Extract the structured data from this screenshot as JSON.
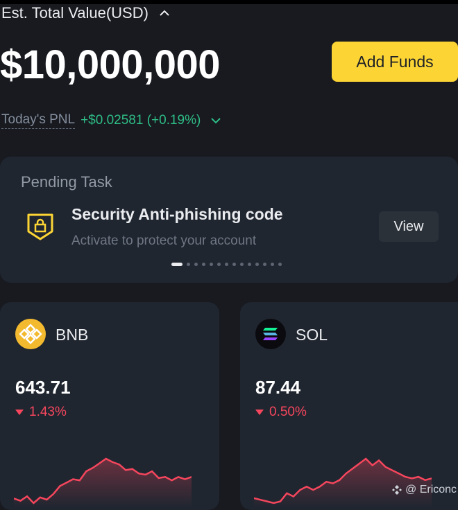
{
  "header": {
    "est_label": "Est. Total Value(USD)",
    "total_value": "$10,000,000",
    "add_funds_label": "Add Funds",
    "pnl_label": "Today's PNL",
    "pnl_value": "+$0.02581 (+0.19%)"
  },
  "pending": {
    "title": "Pending Task",
    "task_title": "Security Anti-phishing code",
    "task_subtitle": "Activate to protect your account",
    "view_label": "View",
    "pager": {
      "count": 14,
      "active": 0
    }
  },
  "cards": [
    {
      "name": "BNB",
      "price": "643.71",
      "change": "1.43%",
      "icon": "bnb-logo-icon",
      "sparkline": [
        22,
        18,
        26,
        14,
        24,
        20,
        30,
        44,
        50,
        56,
        54,
        70,
        76,
        84,
        92,
        86,
        82,
        72,
        74,
        66,
        64,
        70,
        58,
        60,
        54,
        60,
        56,
        60
      ]
    },
    {
      "name": "SOL",
      "price": "87.44",
      "change": "0.50%",
      "icon": "solana-logo-icon",
      "sparkline": [
        30,
        28,
        26,
        24,
        26,
        36,
        32,
        40,
        44,
        40,
        44,
        50,
        48,
        52,
        60,
        66,
        72,
        78,
        70,
        76,
        68,
        64,
        60,
        56,
        54,
        56,
        52,
        54
      ]
    }
  ],
  "colors": {
    "accent": "#fcd535",
    "up": "#2ebd85",
    "down": "#f6465d",
    "card": "#202630",
    "background": "#181a20"
  },
  "watermark": "@ Ericonc"
}
